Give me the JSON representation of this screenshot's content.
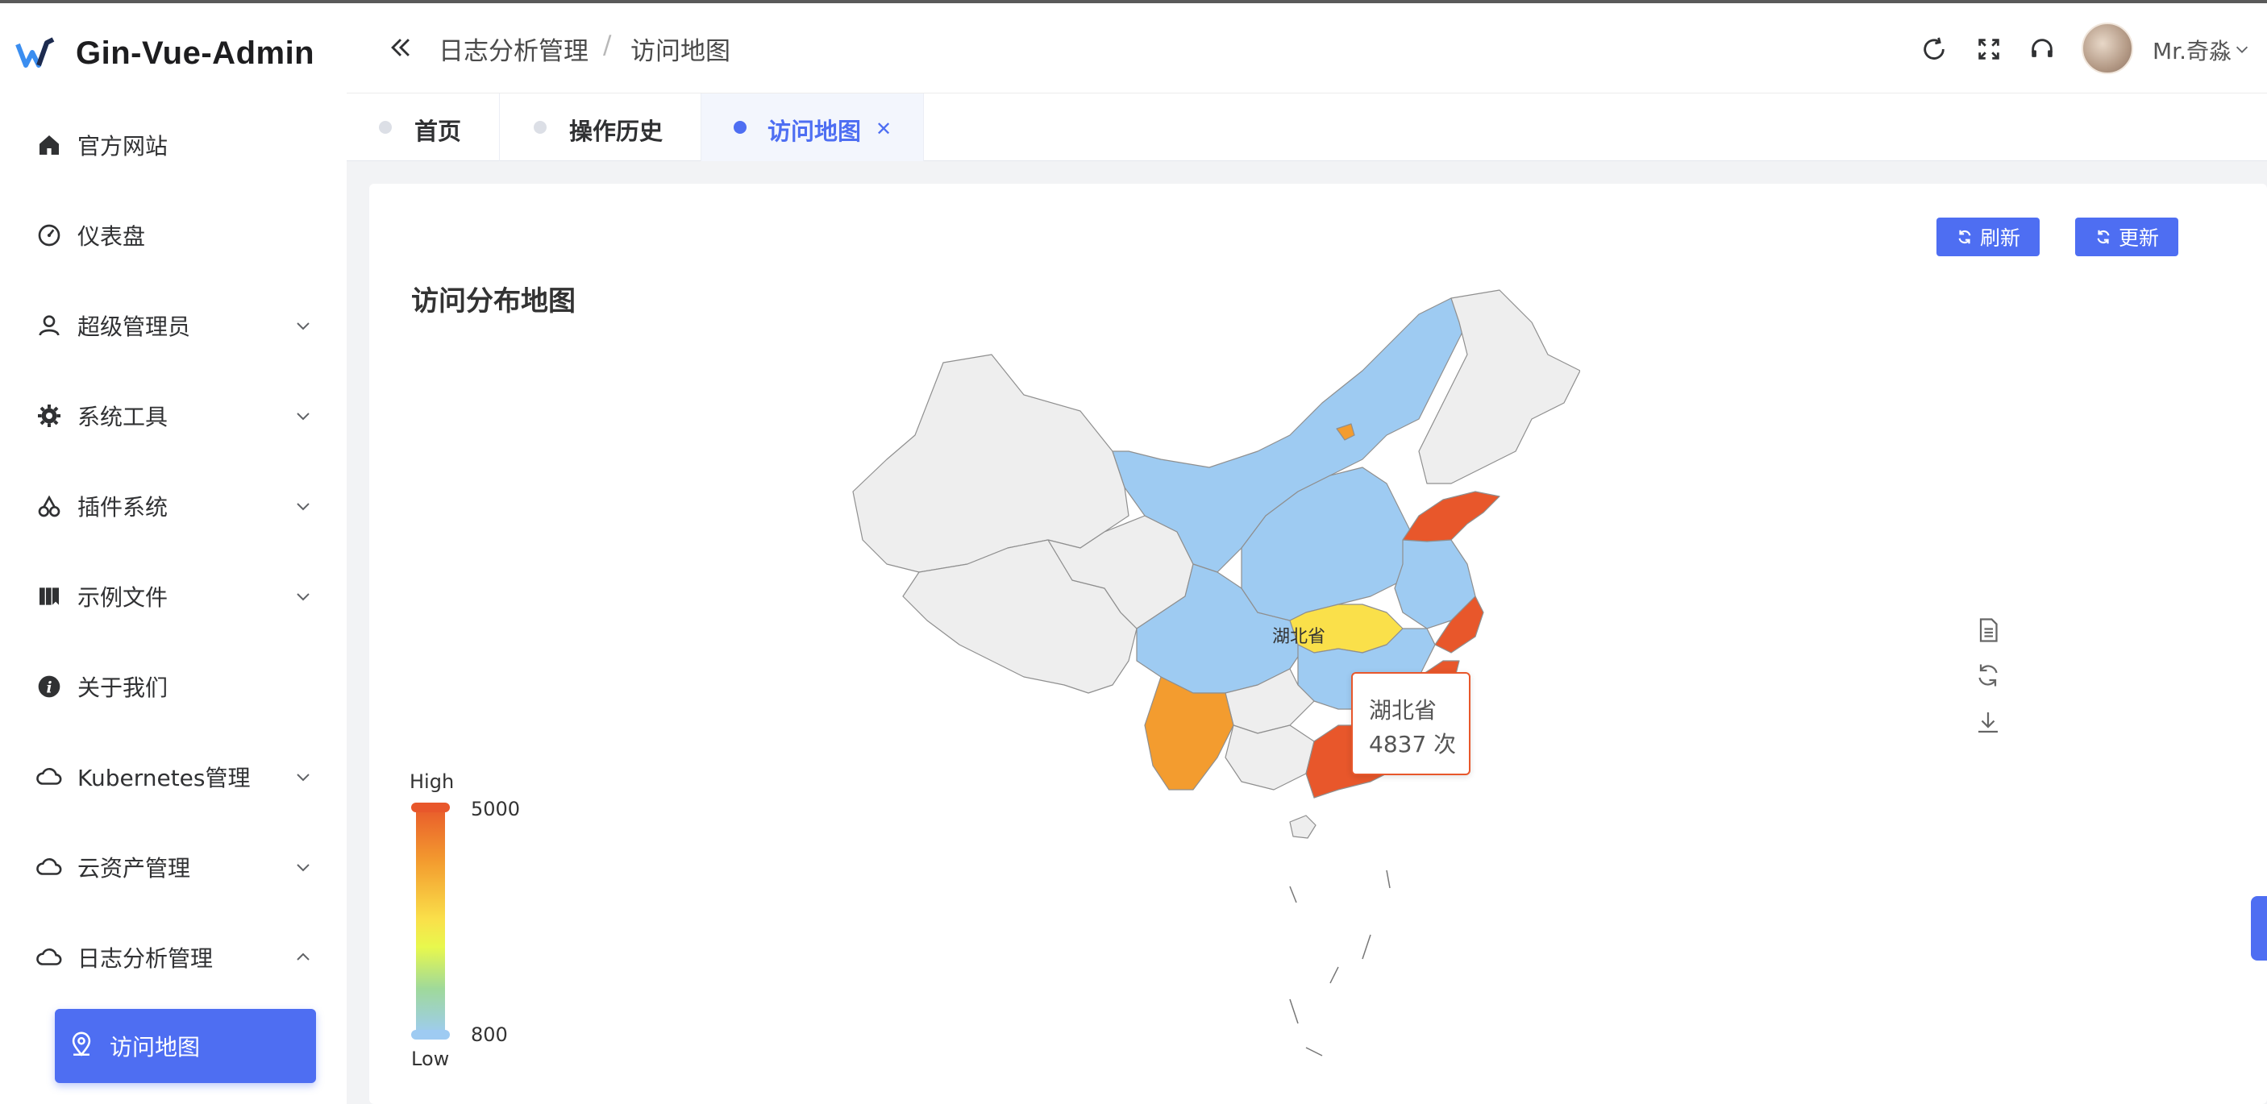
{
  "app": {
    "title": "Gin-Vue-Admin"
  },
  "sidebar": {
    "items": [
      {
        "label": "官方网站",
        "icon": "home-icon",
        "expandable": false
      },
      {
        "label": "仪表盘",
        "icon": "dashboard-icon",
        "expandable": false
      },
      {
        "label": "超级管理员",
        "icon": "user-icon",
        "expandable": true
      },
      {
        "label": "系统工具",
        "icon": "gear-icon",
        "expandable": true
      },
      {
        "label": "插件系统",
        "icon": "cherry-icon",
        "expandable": true
      },
      {
        "label": "示例文件",
        "icon": "folder-icon",
        "expandable": true
      },
      {
        "label": "关于我们",
        "icon": "info-icon",
        "expandable": false
      },
      {
        "label": "Kubernetes管理",
        "icon": "cloud-icon",
        "expandable": true
      },
      {
        "label": "云资产管理",
        "icon": "cloud-icon",
        "expandable": true
      },
      {
        "label": "日志分析管理",
        "icon": "cloud-icon",
        "expandable": true,
        "expanded": true
      }
    ],
    "active_item": {
      "label": "访问地图",
      "icon": "location-icon"
    }
  },
  "header": {
    "breadcrumb": [
      "日志分析管理",
      "访问地图"
    ],
    "username": "Mr.奇淼"
  },
  "tabs": [
    {
      "label": "首页",
      "active": false
    },
    {
      "label": "操作历史",
      "active": false
    },
    {
      "label": "访问地图",
      "active": true,
      "closable": true
    }
  ],
  "page": {
    "title": "访问分布地图",
    "buttons": {
      "refresh": "刷新",
      "update": "更新"
    }
  },
  "chart_data": {
    "type": "heatmap",
    "map": "china",
    "series": [
      {
        "name": "湖北省",
        "value": 4837
      }
    ],
    "highlighted_region": "湖北省",
    "tooltip": {
      "region": "湖北省",
      "value_text": "4837 次"
    },
    "visual_map": {
      "high_label": "High",
      "low_label": "Low",
      "max": "5000",
      "min": "800"
    },
    "colors": {
      "high": "#e8572b",
      "mid_high": "#f39c2f",
      "mid": "#fae04a",
      "low": "#9ecbf2",
      "no_data": "#eeeeee"
    }
  },
  "colors": {
    "accent": "#4e6ef2"
  }
}
